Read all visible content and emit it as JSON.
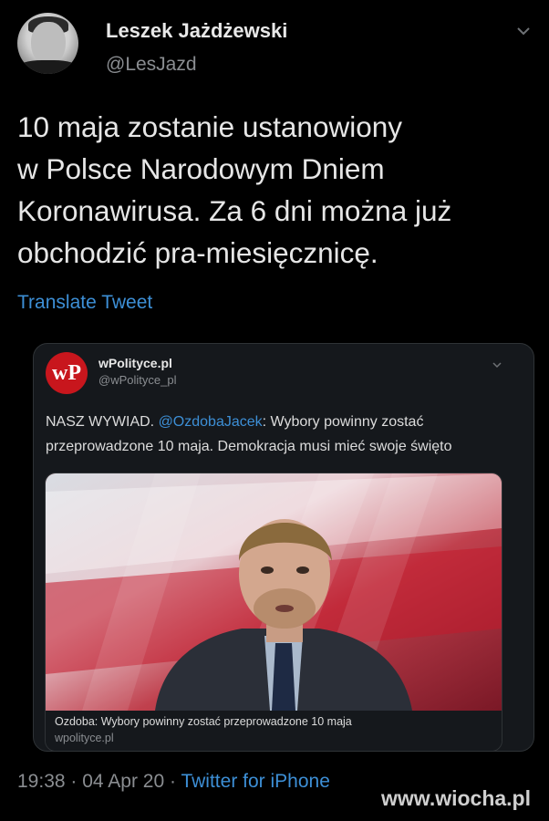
{
  "tweet": {
    "author_name": "Leszek Jażdżewski",
    "author_handle": "@LesJazd",
    "text": "10 maja zostanie ustanowiony\nw Polsce Narodowym Dniem\nKoronawirusa. Za 6 dni można już\nobchodzić pra-miesięcznicę.",
    "translate_label": "Translate Tweet",
    "time": "19:38",
    "date": "04 Apr 20",
    "separator": "·",
    "source_app": "Twitter for iPhone"
  },
  "quoted_tweet": {
    "logo_text": "wP",
    "author_name": "wPolityce.pl",
    "author_handle": "@wPolityce_pl",
    "text_prefix": "NASZ WYWIAD. ",
    "mention": "@OzdobaJacek",
    "text_suffix": ": Wybory powinny zostać przeprowadzone 10 maja. Demokracja musi mieć swoje święto",
    "link_card": {
      "title": "Ozdoba: Wybory powinny zostać przeprowadzone 10 maja",
      "domain": "wpolityce.pl"
    }
  },
  "watermark": "www.wiocha.pl",
  "icons": {
    "tweet_menu": "chevron-down-icon",
    "quoted_menu": "chevron-down-icon"
  },
  "colors": {
    "background": "#000000",
    "link_blue": "#3d8fd6",
    "secondary_text": "#8a8d91",
    "wp_red": "#c8161d"
  }
}
